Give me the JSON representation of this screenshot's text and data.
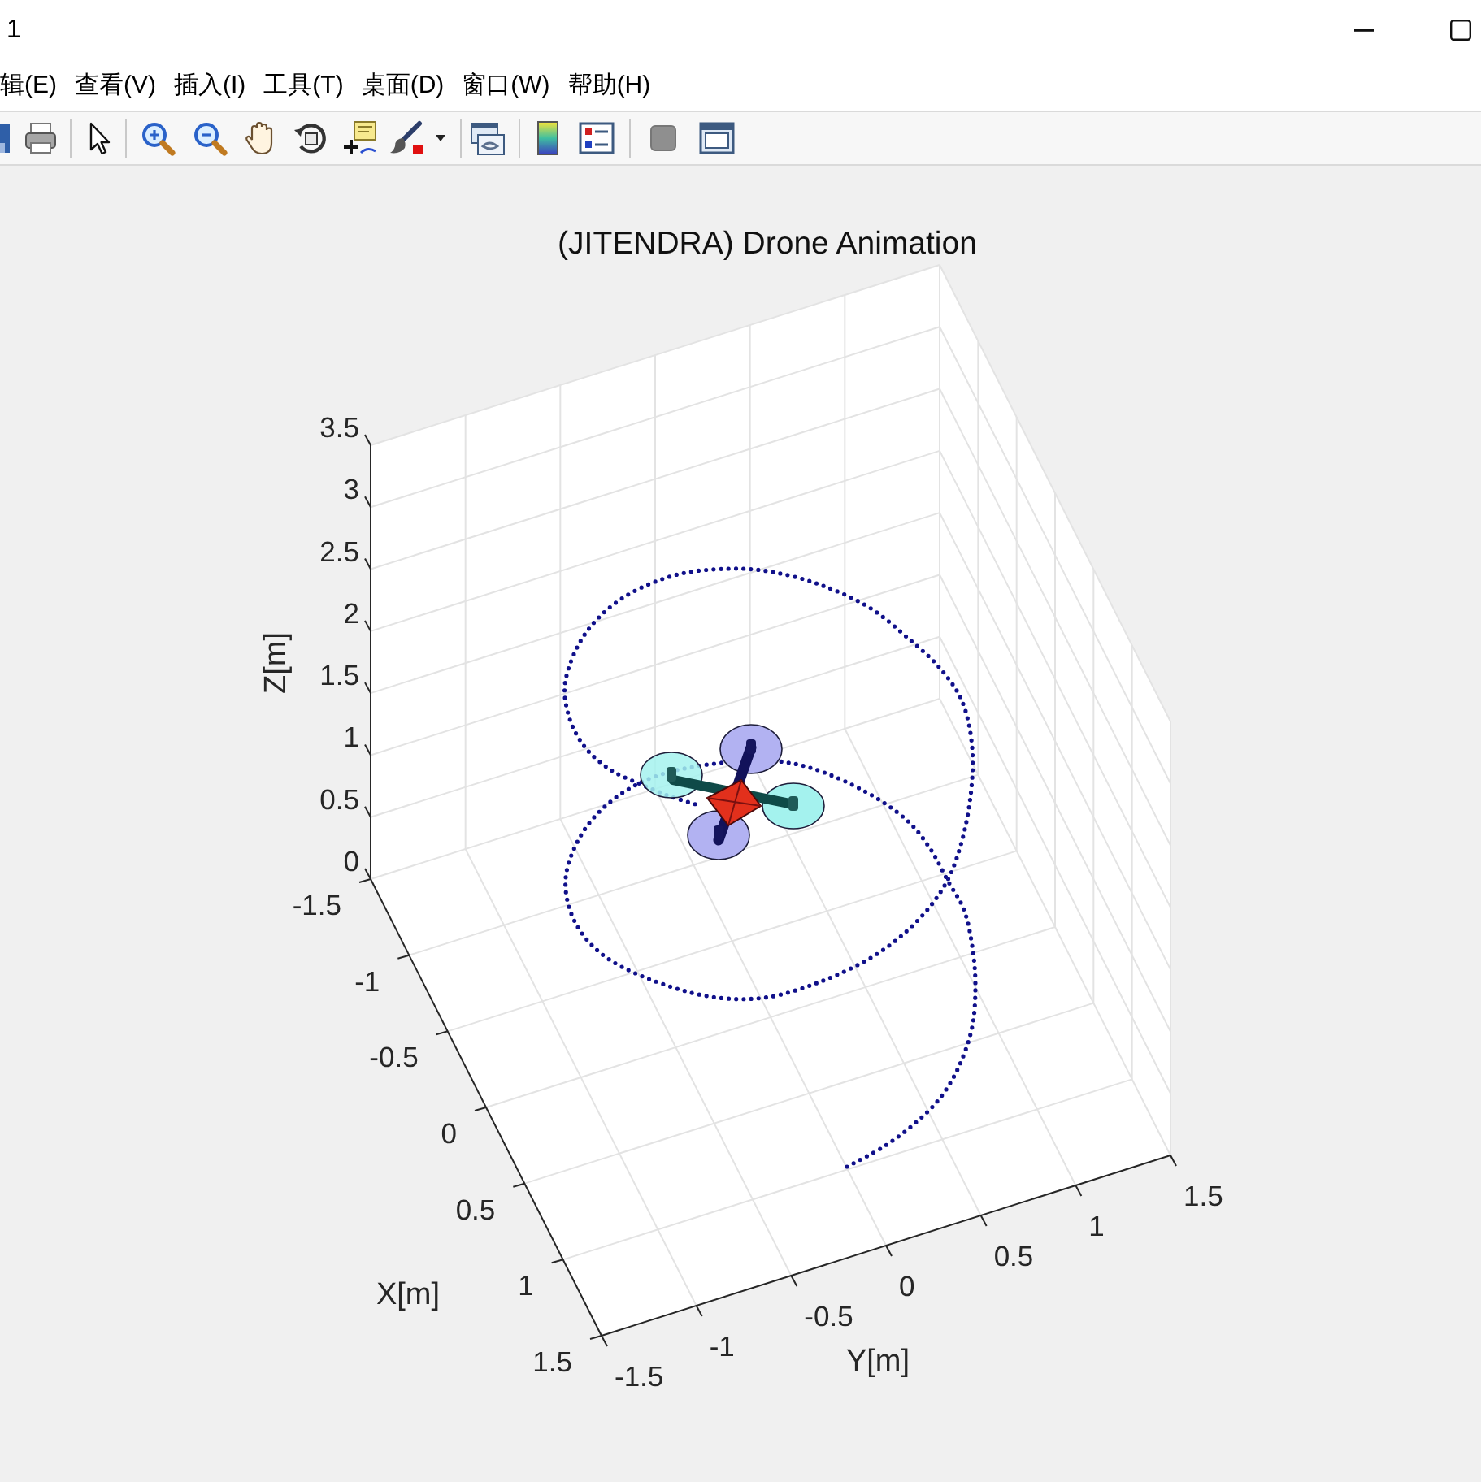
{
  "window": {
    "title": "1"
  },
  "menu_bar": {
    "items": [
      "辑(E)",
      "查看(V)",
      "插入(I)",
      "工具(T)",
      "桌面(D)",
      "窗口(W)",
      "帮助(H)"
    ]
  },
  "axes": {
    "title": "(JITENDRA) Drone Animation",
    "xlabel": "X[m]",
    "ylabel": "Y[m]",
    "zlabel": "Z[m]",
    "xticks": [
      "-1.5",
      "-1",
      "-0.5",
      "0",
      "0.5",
      "1",
      "1.5"
    ],
    "yticks": [
      "-1.5",
      "-1",
      "-0.5",
      "0",
      "0.5",
      "1",
      "1.5"
    ],
    "zticks": [
      "3.5",
      "3",
      "2.5",
      "2",
      "1.5",
      "1",
      "0.5",
      "0"
    ]
  }
}
